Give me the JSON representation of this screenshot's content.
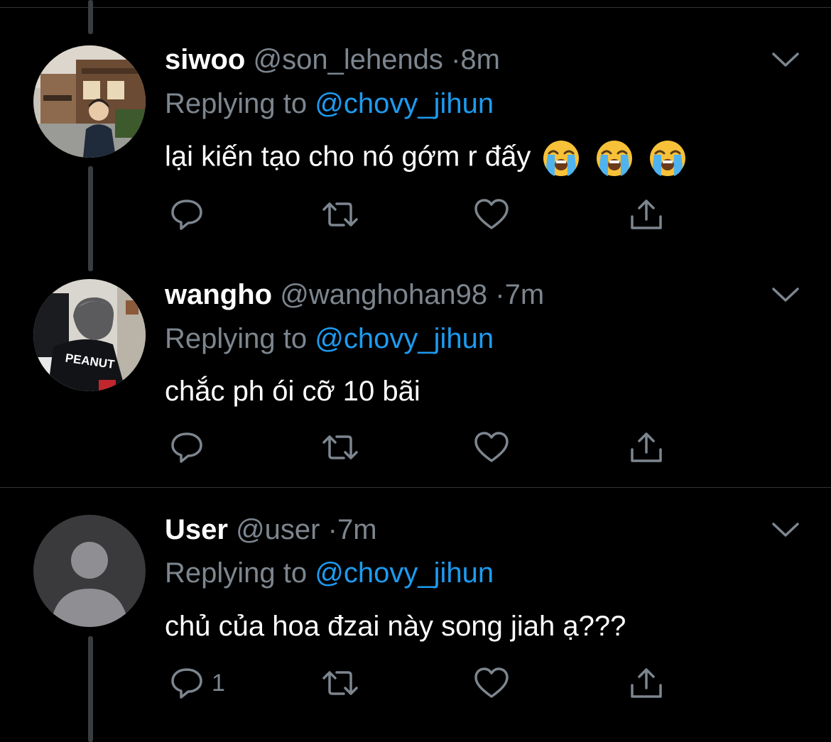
{
  "colors": {
    "background": "#000000",
    "text": "#ffffff",
    "muted": "#7d868f",
    "link": "#1d9bf0",
    "thread_line": "#3a3d40",
    "divider": "#2f3336"
  },
  "tweets": [
    {
      "name": "siwoo",
      "handle": "@son_lehends",
      "separator": "·",
      "time": "8m",
      "replying_prefix": "Replying to ",
      "replying_to": "@chovy_jihun",
      "text": "lại kiến tạo cho nó gớm r đấy",
      "emojis": [
        "loudly-crying-face",
        "loudly-crying-face",
        "loudly-crying-face"
      ],
      "actions": {
        "reply_icon": "reply-icon",
        "retweet_icon": "retweet-icon",
        "like_icon": "heart-icon",
        "share_icon": "share-icon"
      }
    },
    {
      "name": "wangho",
      "handle": "@wanghohan98",
      "separator": "·",
      "time": "7m",
      "replying_prefix": "Replying to ",
      "replying_to": "@chovy_jihun",
      "text": "chắc ph ói cỡ 10 bãi",
      "avatar_jacket_text": "PEANUT",
      "actions": {
        "reply_icon": "reply-icon",
        "retweet_icon": "retweet-icon",
        "like_icon": "heart-icon",
        "share_icon": "share-icon"
      }
    },
    {
      "name": "User",
      "handle": "@user",
      "separator": "·",
      "time": "7m",
      "replying_prefix": "Replying to ",
      "replying_to": "@chovy_jihun",
      "text": "chủ của hoa đzai này song jiah ạ???",
      "reply_count": "1",
      "actions": {
        "reply_icon": "reply-icon",
        "retweet_icon": "retweet-icon",
        "like_icon": "heart-icon",
        "share_icon": "share-icon"
      }
    }
  ]
}
